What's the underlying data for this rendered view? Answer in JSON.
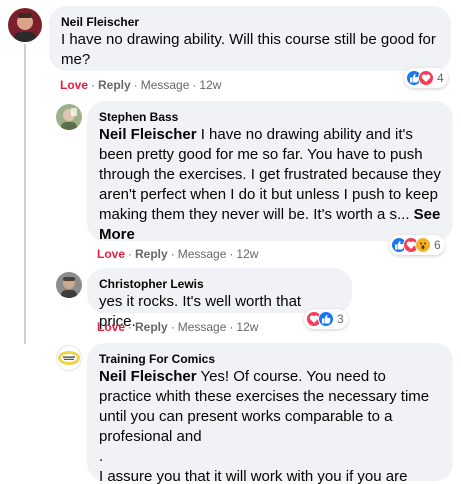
{
  "comments": [
    {
      "author": "Neil Fleischer",
      "text": "I have no drawing ability. Will this course still be good for me?",
      "actions": {
        "love": "Love",
        "reply": "Reply",
        "message": "Message",
        "time": "12w"
      },
      "reactions": {
        "icons": [
          "like-icon",
          "love-icon"
        ],
        "count": "4"
      }
    },
    {
      "author": "Stephen Bass",
      "mention": "Neil Fleischer",
      "text": " I have no drawing ability and it's been pretty good for me so far. You have to push through the exercises. I get frustrated because they aren't perfect when I do it but unless I push to keep making them they never will be. It's worth a s... ",
      "see_more": "See More",
      "actions": {
        "love": "Love",
        "reply": "Reply",
        "message": "Message",
        "time": "12w"
      },
      "reactions": {
        "icons": [
          "like-icon",
          "love-icon",
          "wow-icon"
        ],
        "count": "6"
      }
    },
    {
      "author": "Christopher Lewis",
      "text": "yes it rocks. It's well worth that price.",
      "actions": {
        "love": "Love",
        "reply": "Reply",
        "message": "Message",
        "time": "12w"
      },
      "reactions": {
        "icons": [
          "love-icon",
          "like-icon"
        ],
        "count": "3"
      }
    },
    {
      "author": "Training For Comics",
      "mention": "Neil Fleischer",
      "text": " Yes! Of course. You need to practice whith these exercises the necessary time until you can present works comparable to a profesional and",
      "text2": ".",
      "text3": "I assure you that it will work with you if you are prepared to make the effort"
    }
  ],
  "colors": {
    "bubble": "#f0f2f5",
    "love": "#e41e3f",
    "like_blue": "#1877f2",
    "muted": "#65676b",
    "wow_yellow": "#f7b125"
  }
}
